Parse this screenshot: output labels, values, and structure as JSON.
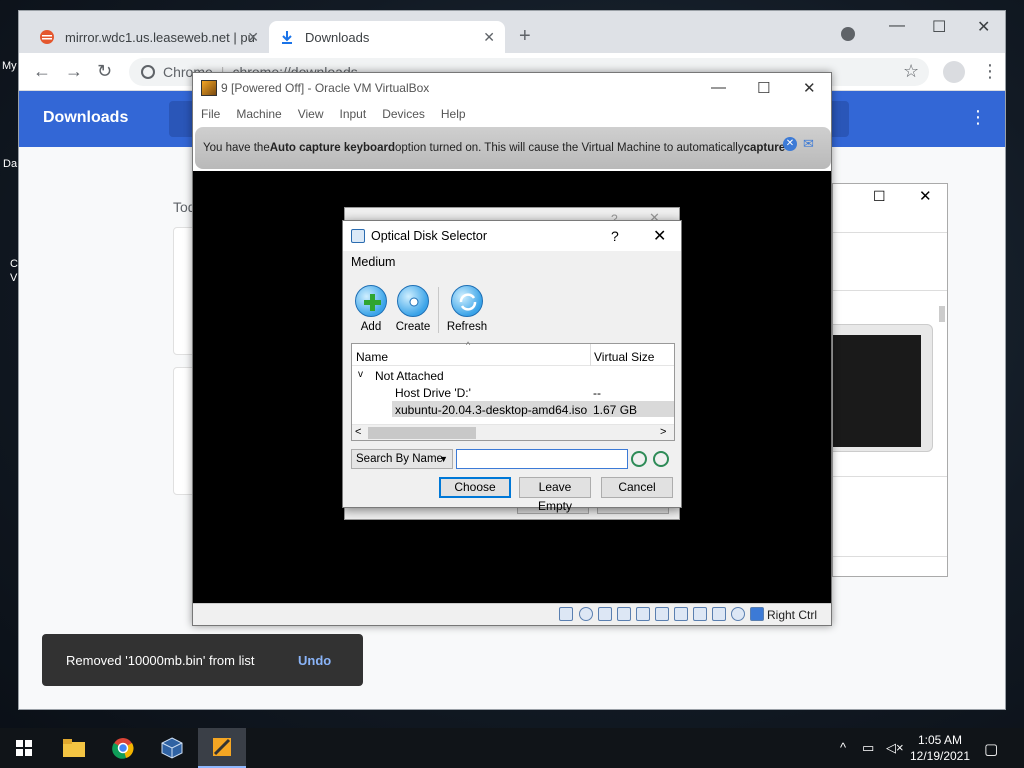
{
  "desktop": {
    "icon1_label": "My",
    "icon2_label": "Da",
    "icon3_label": "C",
    "icon4_label": "V"
  },
  "chrome": {
    "tabs": [
      {
        "label": "mirror.wdc1.us.leaseweb.net | pu",
        "active": false
      },
      {
        "label": "Downloads",
        "active": true
      }
    ],
    "omnibox": {
      "site_label": "Chrome",
      "url": "chrome://downloads"
    },
    "downloads": {
      "title": "Downloads",
      "section_label": "Tod"
    }
  },
  "virtualbox": {
    "title": "9 [Powered Off] - Oracle VM VirtualBox",
    "menu": [
      "File",
      "Machine",
      "View",
      "Input",
      "Devices",
      "Help"
    ],
    "notice": {
      "prefix": "You have the ",
      "bold1": "Auto capture keyboard",
      "middle": " option turned on. This will cause the Virtual Machine to automatically ",
      "bold2": "capture"
    },
    "status": {
      "host_key": "Right Ctrl"
    }
  },
  "optical_disk_selector": {
    "title": "Optical Disk Selector",
    "help": "?",
    "section": "Medium",
    "tools": [
      {
        "label": "Add",
        "icon": "add-disk-icon"
      },
      {
        "label": "Create",
        "icon": "create-disk-icon"
      },
      {
        "label": "Refresh",
        "icon": "refresh-icon"
      }
    ],
    "columns": {
      "name": "Name",
      "size": "Virtual Size"
    },
    "group": "Not Attached",
    "rows": [
      {
        "name": "Host Drive 'D:'",
        "size": "--"
      },
      {
        "name": "xubuntu-20.04.3-desktop-amd64.iso",
        "size": "1.67 GB",
        "selected": true
      }
    ],
    "search": {
      "mode": "Search By Name",
      "value": ""
    },
    "buttons": {
      "choose": "Choose",
      "leave_empty": "Leave Empty",
      "cancel": "Cancel"
    }
  },
  "toast": {
    "message": "Removed '10000mb.bin' from list",
    "action": "Undo"
  },
  "taskbar": {
    "time": "1:05 AM",
    "date": "12/19/2021"
  }
}
